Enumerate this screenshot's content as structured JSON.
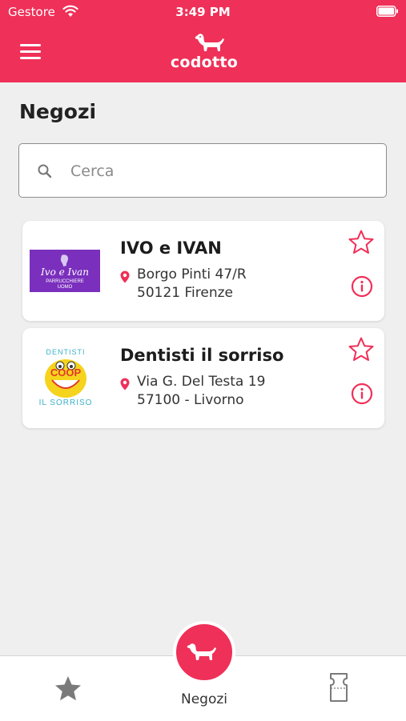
{
  "status_bar": {
    "carrier": "Gestore",
    "time": "3:49 PM"
  },
  "header": {
    "logo_text": "codotto"
  },
  "page": {
    "title": "Negozi"
  },
  "search": {
    "placeholder": "Cerca",
    "value": ""
  },
  "shops": [
    {
      "name": "IVO e IVAN",
      "address_line1": "Borgo Pinti 47/R",
      "address_line2": "50121 Firenze",
      "logo_text": {
        "line1": "Ivo e Ivan",
        "line2": "PARRUCCHIERE",
        "line3": "UOMO"
      }
    },
    {
      "name": "Dentisti il sorriso",
      "address_line1": "Via G. Del Testa 19",
      "address_line2": "57100 - Livorno",
      "logo_text": {
        "top": "DENTISTI",
        "middle": "COOP",
        "bottom": "IL SORRISO"
      }
    }
  ],
  "tab_bar": {
    "shops_label": "Negozi"
  },
  "colors": {
    "brand": "#ef3058",
    "background": "#efefef",
    "logo_purple": "#7a2fbd"
  },
  "icons": [
    "wifi-icon",
    "battery-icon",
    "menu-icon",
    "dog-icon",
    "search-icon",
    "location-pin-icon",
    "star-outline-icon",
    "info-icon",
    "star-filled-icon",
    "ticket-icon"
  ]
}
